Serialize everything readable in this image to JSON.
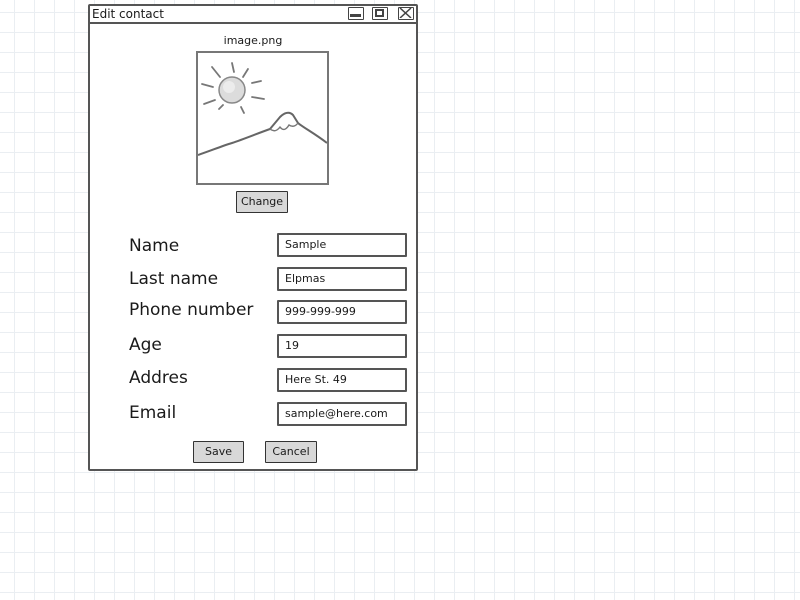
{
  "window": {
    "title": "Edit contact",
    "controls": [
      "minimize-icon",
      "maximize-icon",
      "close-icon"
    ]
  },
  "image": {
    "filename": "image.png",
    "icon": "landscape-image-icon",
    "change_label": "Change"
  },
  "form": {
    "fields": [
      {
        "label": "Name",
        "value": "Sample"
      },
      {
        "label": "Last name",
        "value": "Elpmas"
      },
      {
        "label": "Phone number",
        "value": "999-999-999"
      },
      {
        "label": "Age",
        "value": "19"
      },
      {
        "label": "Addres",
        "value": "Here St. 49"
      },
      {
        "label": "Email",
        "value": "sample@here.com"
      }
    ]
  },
  "actions": {
    "save_label": "Save",
    "cancel_label": "Cancel"
  },
  "colors": {
    "button_fill": "#d8d8d8",
    "border": "#555555",
    "grid": "#eaeef2"
  }
}
